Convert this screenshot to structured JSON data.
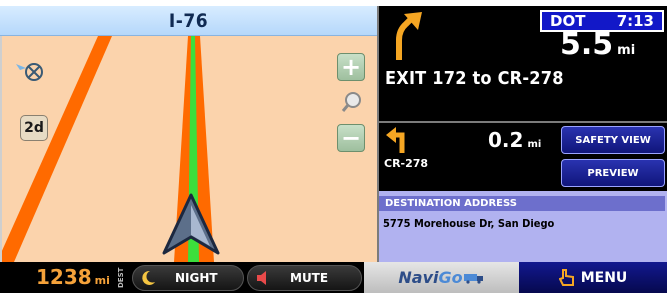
{
  "map": {
    "street_name": "I-76",
    "view_mode": "2d",
    "colors": {
      "background": "#fbd3ac",
      "route": "#3cde3c",
      "road": "#ff6a00"
    }
  },
  "maneuver": {
    "distance": "5.5",
    "distance_unit": "mi",
    "instruction": "EXIT 172 to CR-278",
    "direction_icon": "bear-right-arrow-icon"
  },
  "status": {
    "mode_label": "DOT",
    "time": "7:13"
  },
  "next_maneuver": {
    "distance": "0.2",
    "distance_unit": "mi",
    "street": "CR-278",
    "direction_icon": "turn-left-arrow-icon"
  },
  "side_buttons": {
    "safety_view": "SAFETY VIEW",
    "preview": "PREVIEW"
  },
  "destination": {
    "label": "DESTINATION ADDRESS",
    "address": "5775 Morehouse Dr, San Diego"
  },
  "bottom_bar": {
    "remaining_distance": "1238",
    "remaining_unit": "mi",
    "dest_tag": "DEST",
    "night_label": "NIGHT",
    "mute_label": "MUTE",
    "logo_part1": "Navi",
    "logo_part2": "Go",
    "menu_label": "MENU"
  }
}
